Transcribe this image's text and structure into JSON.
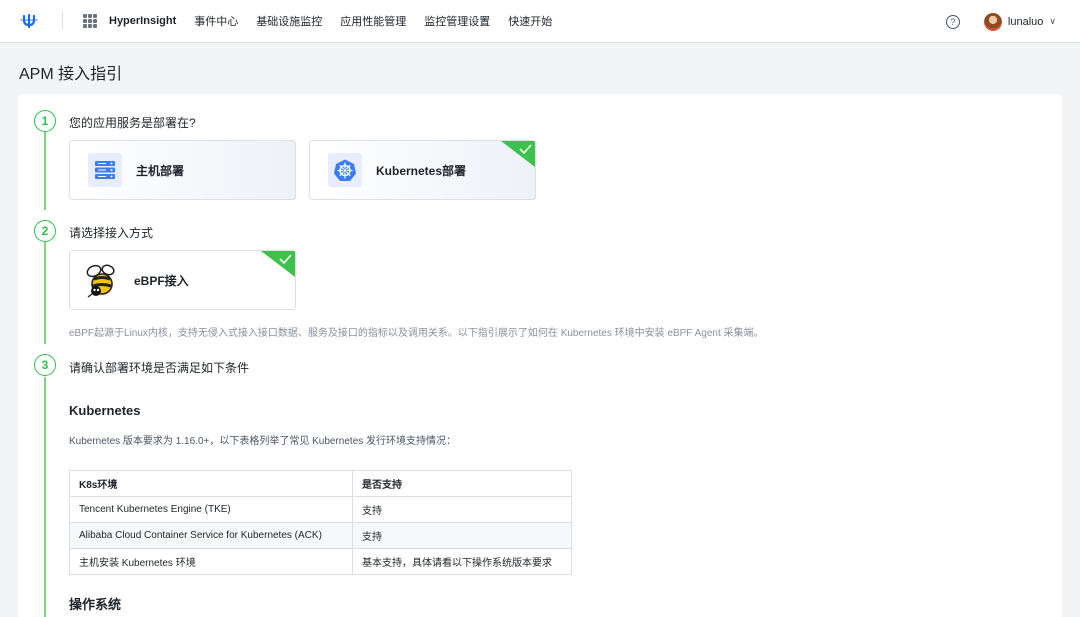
{
  "nav": {
    "product": "HyperInsight",
    "items": [
      "事件中心",
      "基础设施监控",
      "应用性能管理",
      "监控管理设置",
      "快速开始"
    ],
    "user": "lunaluo",
    "help_glyph": "?",
    "caret_glyph": "∨"
  },
  "page": {
    "title": "APM 接入指引"
  },
  "steps": [
    {
      "number": "1",
      "title": "您的应用服务是部署在?"
    },
    {
      "number": "2",
      "title": "请选择接入方式"
    },
    {
      "number": "3",
      "title": "请确认部署环境是否满足如下条件"
    }
  ],
  "deploy_options": [
    {
      "label": "主机部署",
      "icon": "server-icon",
      "selected": false
    },
    {
      "label": "Kubernetes部署",
      "icon": "kubernetes-icon",
      "selected": true
    }
  ],
  "access_options": [
    {
      "label": "eBPF接入",
      "icon": "bee-icon",
      "selected": true
    }
  ],
  "access_note": "eBPF起源于Linux内核，支持无侵入式接入接口数据、服务及接口的指标以及调用关系。以下指引展示了如何在 Kubernetes 环境中安装 eBPF Agent 采集端。",
  "requirements": {
    "k8s_title": "Kubernetes",
    "k8s_desc": "Kubernetes 版本要求为 1.16.0+，以下表格列举了常见 Kubernetes 发行环境支持情况：",
    "table_headers": [
      "K8s环境",
      "是否支持"
    ],
    "table_rows": [
      [
        "Tencent Kubernetes Engine (TKE)",
        "支持"
      ],
      [
        "Alibaba Cloud Container Service for Kubernetes (ACK)",
        "支持"
      ],
      [
        "主机安装 Kubernetes 环境",
        "基本支持，具体请看以下操作系统版本要求"
      ]
    ],
    "os_title": "操作系统"
  },
  "colors": {
    "accent_green": "#2fbf4a",
    "brand_blue": "#1a6df5",
    "check_green": "#3cc24a"
  }
}
